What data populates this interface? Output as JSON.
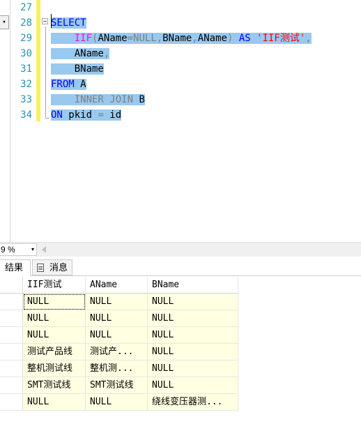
{
  "editor": {
    "nav_arrow": "▾",
    "line_numbers": [
      "27",
      "28",
      "29",
      "30",
      "31",
      "32",
      "33",
      "34"
    ],
    "lines": [
      [],
      [
        {
          "t": "SELECT",
          "c": "kw"
        }
      ],
      [
        {
          "t": "    ",
          "c": "txt"
        },
        {
          "t": "IIF",
          "c": "fn"
        },
        {
          "t": "(",
          "c": "gray"
        },
        {
          "t": "AName",
          "c": "txt"
        },
        {
          "t": "=",
          "c": "gray"
        },
        {
          "t": "NULL",
          "c": "gray"
        },
        {
          "t": ",",
          "c": "gray"
        },
        {
          "t": "BName",
          "c": "txt"
        },
        {
          "t": ",",
          "c": "gray"
        },
        {
          "t": "AName",
          "c": "txt"
        },
        {
          "t": ")",
          "c": "gray"
        },
        {
          "t": " ",
          "c": "txt"
        },
        {
          "t": "AS",
          "c": "kw"
        },
        {
          "t": " ",
          "c": "txt"
        },
        {
          "t": "'IIF测试'",
          "c": "str"
        },
        {
          "t": ",",
          "c": "gray"
        }
      ],
      [
        {
          "t": "    ",
          "c": "txt"
        },
        {
          "t": "AName",
          "c": "txt"
        },
        {
          "t": ",",
          "c": "gray"
        }
      ],
      [
        {
          "t": "    ",
          "c": "txt"
        },
        {
          "t": "BName",
          "c": "txt"
        }
      ],
      [
        {
          "t": "FROM",
          "c": "kw"
        },
        {
          "t": " A",
          "c": "txt"
        }
      ],
      [
        {
          "t": "    ",
          "c": "txt"
        },
        {
          "t": "INNER JOIN",
          "c": "gray"
        },
        {
          "t": " B",
          "c": "txt"
        }
      ],
      [
        {
          "t": "ON",
          "c": "kw"
        },
        {
          "t": " pkid ",
          "c": "txt"
        },
        {
          "t": "=",
          "c": "gray"
        },
        {
          "t": " id",
          "c": "txt"
        }
      ]
    ]
  },
  "zoom": {
    "value": "9 %",
    "arrow": "▾"
  },
  "tabs": {
    "results": "结果",
    "messages": "消息"
  },
  "grid": {
    "columns": [
      "IIF测试",
      "AName",
      "BName"
    ],
    "rows": [
      [
        "NULL",
        "NULL",
        "NULL"
      ],
      [
        "NULL",
        "NULL",
        "NULL"
      ],
      [
        "NULL",
        "NULL",
        "NULL"
      ],
      [
        "测试产品线",
        "测试产...",
        "NULL"
      ],
      [
        "整机测试线",
        "整机测...",
        "NULL"
      ],
      [
        "SMT测试线",
        "SMT测试线",
        "NULL"
      ],
      [
        "NULL",
        "NULL",
        "绕线变压器测..."
      ]
    ]
  },
  "colors": {
    "keyword": "#0000ff",
    "function": "#ff00ff",
    "string": "#ff0000",
    "operator": "#808080",
    "selection": "#99c9ef",
    "line_number": "#2b91af",
    "grid_cell": "#ffffe1"
  }
}
